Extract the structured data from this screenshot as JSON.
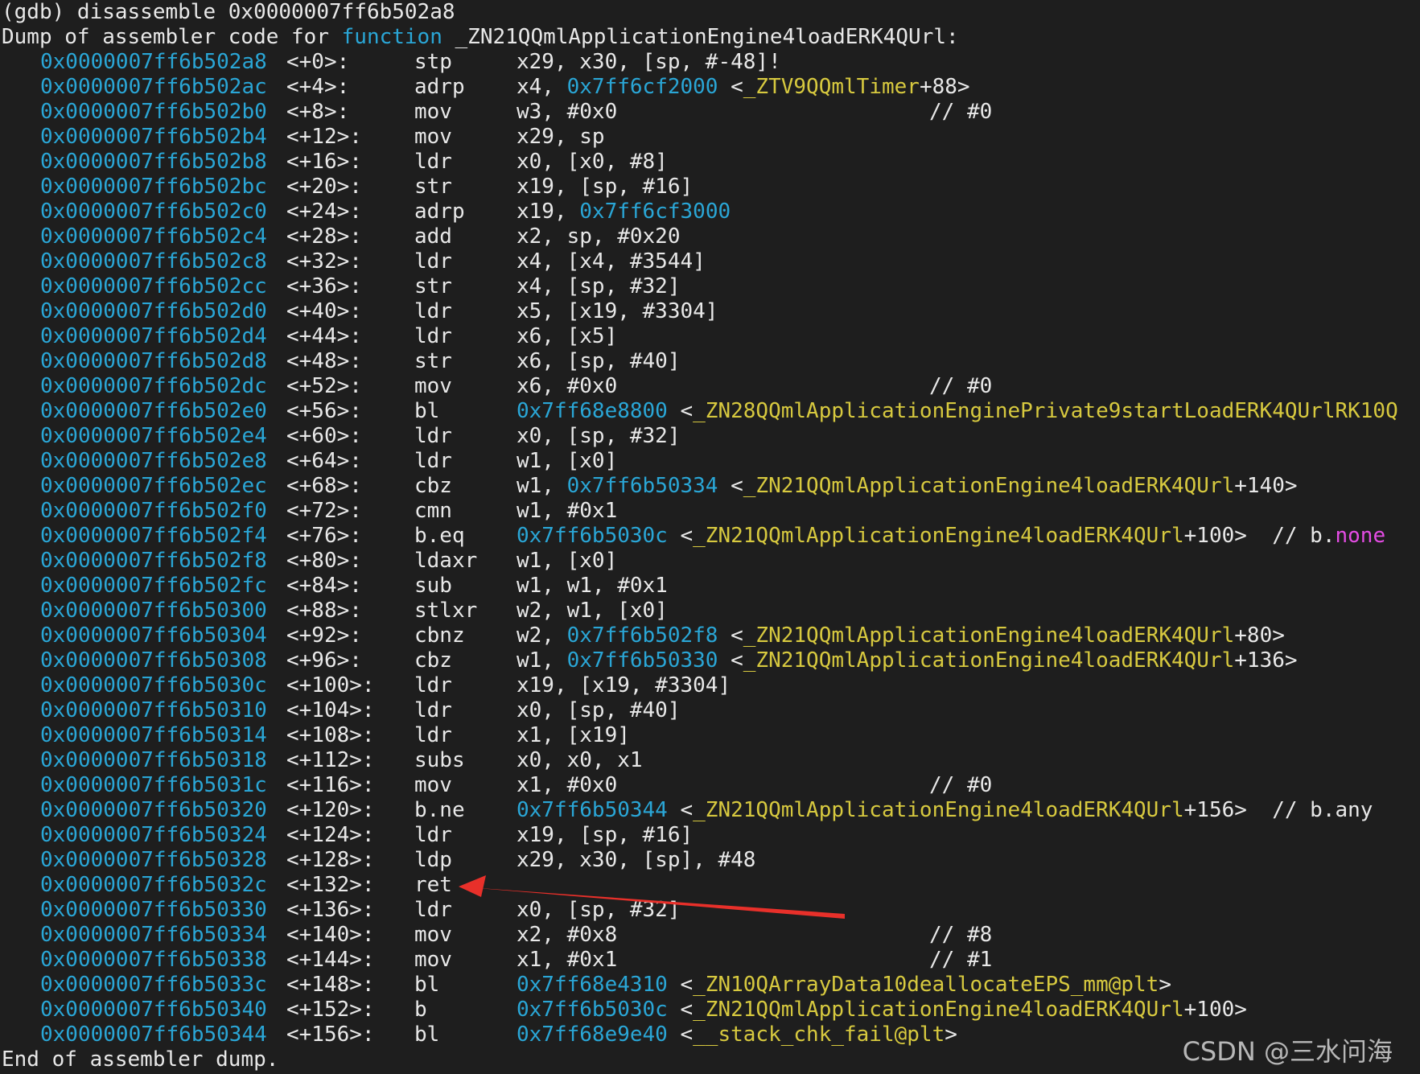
{
  "prompt_line": "(gdb) disassemble 0x0000007ff6b502a8",
  "header": {
    "prefix": "Dump of assembler code for ",
    "keyword": "function",
    "symbol": " _ZN21QQmlApplicationEngine4loadERK4QUrl:"
  },
  "rows": [
    {
      "addr": "0x0000007ff6b502a8",
      "offset": "<+0>:",
      "mnemonic": "stp",
      "operands": [
        {
          "t": "x29, x30, [sp, #-48]!",
          "c": "white"
        }
      ],
      "comment": ""
    },
    {
      "addr": "0x0000007ff6b502ac",
      "offset": "<+4>:",
      "mnemonic": "adrp",
      "operands": [
        {
          "t": "x4, ",
          "c": "white"
        },
        {
          "t": "0x7ff6cf2000",
          "c": "blue"
        },
        {
          "t": " <",
          "c": "white"
        },
        {
          "t": "_ZTV9QQmlTimer",
          "c": "yellow"
        },
        {
          "t": "+88>",
          "c": "white"
        }
      ],
      "comment": ""
    },
    {
      "addr": "0x0000007ff6b502b0",
      "offset": "<+8>:",
      "mnemonic": "mov",
      "operands": [
        {
          "t": "w3, #0x0",
          "c": "white"
        }
      ],
      "comment": "// #0"
    },
    {
      "addr": "0x0000007ff6b502b4",
      "offset": "<+12>:",
      "mnemonic": "mov",
      "operands": [
        {
          "t": "x29, sp",
          "c": "white"
        }
      ],
      "comment": ""
    },
    {
      "addr": "0x0000007ff6b502b8",
      "offset": "<+16>:",
      "mnemonic": "ldr",
      "operands": [
        {
          "t": "x0, [x0, #8]",
          "c": "white"
        }
      ],
      "comment": ""
    },
    {
      "addr": "0x0000007ff6b502bc",
      "offset": "<+20>:",
      "mnemonic": "str",
      "operands": [
        {
          "t": "x19, [sp, #16]",
          "c": "white"
        }
      ],
      "comment": ""
    },
    {
      "addr": "0x0000007ff6b502c0",
      "offset": "<+24>:",
      "mnemonic": "adrp",
      "operands": [
        {
          "t": "x19, ",
          "c": "white"
        },
        {
          "t": "0x7ff6cf3000",
          "c": "blue"
        }
      ],
      "comment": ""
    },
    {
      "addr": "0x0000007ff6b502c4",
      "offset": "<+28>:",
      "mnemonic": "add",
      "operands": [
        {
          "t": "x2, sp, #0x20",
          "c": "white"
        }
      ],
      "comment": ""
    },
    {
      "addr": "0x0000007ff6b502c8",
      "offset": "<+32>:",
      "mnemonic": "ldr",
      "operands": [
        {
          "t": "x4, [x4, #3544]",
          "c": "white"
        }
      ],
      "comment": ""
    },
    {
      "addr": "0x0000007ff6b502cc",
      "offset": "<+36>:",
      "mnemonic": "str",
      "operands": [
        {
          "t": "x4, [sp, #32]",
          "c": "white"
        }
      ],
      "comment": ""
    },
    {
      "addr": "0x0000007ff6b502d0",
      "offset": "<+40>:",
      "mnemonic": "ldr",
      "operands": [
        {
          "t": "x5, [x19, #3304]",
          "c": "white"
        }
      ],
      "comment": ""
    },
    {
      "addr": "0x0000007ff6b502d4",
      "offset": "<+44>:",
      "mnemonic": "ldr",
      "operands": [
        {
          "t": "x6, [x5]",
          "c": "white"
        }
      ],
      "comment": ""
    },
    {
      "addr": "0x0000007ff6b502d8",
      "offset": "<+48>:",
      "mnemonic": "str",
      "operands": [
        {
          "t": "x6, [sp, #40]",
          "c": "white"
        }
      ],
      "comment": ""
    },
    {
      "addr": "0x0000007ff6b502dc",
      "offset": "<+52>:",
      "mnemonic": "mov",
      "operands": [
        {
          "t": "x6, #0x0",
          "c": "white"
        }
      ],
      "comment": "// #0"
    },
    {
      "addr": "0x0000007ff6b502e0",
      "offset": "<+56>:",
      "mnemonic": "bl",
      "operands": [
        {
          "t": "0x7ff68e8800",
          "c": "blue"
        },
        {
          "t": " <",
          "c": "white"
        },
        {
          "t": "_ZN28QQmlApplicationEnginePrivate9startLoadERK4QUrlRK10Q",
          "c": "yellow"
        }
      ],
      "comment": ""
    },
    {
      "addr": "0x0000007ff6b502e4",
      "offset": "<+60>:",
      "mnemonic": "ldr",
      "operands": [
        {
          "t": "x0, [sp, #32]",
          "c": "white"
        }
      ],
      "comment": ""
    },
    {
      "addr": "0x0000007ff6b502e8",
      "offset": "<+64>:",
      "mnemonic": "ldr",
      "operands": [
        {
          "t": "w1, [x0]",
          "c": "white"
        }
      ],
      "comment": ""
    },
    {
      "addr": "0x0000007ff6b502ec",
      "offset": "<+68>:",
      "mnemonic": "cbz",
      "operands": [
        {
          "t": "w1, ",
          "c": "white"
        },
        {
          "t": "0x7ff6b50334",
          "c": "blue"
        },
        {
          "t": " <",
          "c": "white"
        },
        {
          "t": "_ZN21QQmlApplicationEngine4loadERK4QUrl",
          "c": "yellow"
        },
        {
          "t": "+140>",
          "c": "white"
        }
      ],
      "comment": ""
    },
    {
      "addr": "0x0000007ff6b502f0",
      "offset": "<+72>:",
      "mnemonic": "cmn",
      "operands": [
        {
          "t": "w1, #0x1",
          "c": "white"
        }
      ],
      "comment": ""
    },
    {
      "addr": "0x0000007ff6b502f4",
      "offset": "<+76>:",
      "mnemonic": "b.eq",
      "operands": [
        {
          "t": "0x7ff6b5030c",
          "c": "blue"
        },
        {
          "t": " <",
          "c": "white"
        },
        {
          "t": "_ZN21QQmlApplicationEngine4loadERK4QUrl",
          "c": "yellow"
        },
        {
          "t": "+100>  // b.",
          "c": "white"
        },
        {
          "t": "none",
          "c": "magenta"
        }
      ],
      "comment": ""
    },
    {
      "addr": "0x0000007ff6b502f8",
      "offset": "<+80>:",
      "mnemonic": "ldaxr",
      "operands": [
        {
          "t": "w1, [x0]",
          "c": "white"
        }
      ],
      "comment": ""
    },
    {
      "addr": "0x0000007ff6b502fc",
      "offset": "<+84>:",
      "mnemonic": "sub",
      "operands": [
        {
          "t": "w1, w1, #0x1",
          "c": "white"
        }
      ],
      "comment": ""
    },
    {
      "addr": "0x0000007ff6b50300",
      "offset": "<+88>:",
      "mnemonic": "stlxr",
      "operands": [
        {
          "t": "w2, w1, [x0]",
          "c": "white"
        }
      ],
      "comment": ""
    },
    {
      "addr": "0x0000007ff6b50304",
      "offset": "<+92>:",
      "mnemonic": "cbnz",
      "operands": [
        {
          "t": "w2, ",
          "c": "white"
        },
        {
          "t": "0x7ff6b502f8",
          "c": "blue"
        },
        {
          "t": " <",
          "c": "white"
        },
        {
          "t": "_ZN21QQmlApplicationEngine4loadERK4QUrl",
          "c": "yellow"
        },
        {
          "t": "+80>",
          "c": "white"
        }
      ],
      "comment": ""
    },
    {
      "addr": "0x0000007ff6b50308",
      "offset": "<+96>:",
      "mnemonic": "cbz",
      "operands": [
        {
          "t": "w1, ",
          "c": "white"
        },
        {
          "t": "0x7ff6b50330",
          "c": "blue"
        },
        {
          "t": " <",
          "c": "white"
        },
        {
          "t": "_ZN21QQmlApplicationEngine4loadERK4QUrl",
          "c": "yellow"
        },
        {
          "t": "+136>",
          "c": "white"
        }
      ],
      "comment": ""
    },
    {
      "addr": "0x0000007ff6b5030c",
      "offset": "<+100>:",
      "mnemonic": "ldr",
      "operands": [
        {
          "t": "x19, [x19, #3304]",
          "c": "white"
        }
      ],
      "comment": ""
    },
    {
      "addr": "0x0000007ff6b50310",
      "offset": "<+104>:",
      "mnemonic": "ldr",
      "operands": [
        {
          "t": "x0, [sp, #40]",
          "c": "white"
        }
      ],
      "comment": ""
    },
    {
      "addr": "0x0000007ff6b50314",
      "offset": "<+108>:",
      "mnemonic": "ldr",
      "operands": [
        {
          "t": "x1, [x19]",
          "c": "white"
        }
      ],
      "comment": ""
    },
    {
      "addr": "0x0000007ff6b50318",
      "offset": "<+112>:",
      "mnemonic": "subs",
      "operands": [
        {
          "t": "x0, x0, x1",
          "c": "white"
        }
      ],
      "comment": ""
    },
    {
      "addr": "0x0000007ff6b5031c",
      "offset": "<+116>:",
      "mnemonic": "mov",
      "operands": [
        {
          "t": "x1, #0x0",
          "c": "white"
        }
      ],
      "comment": "// #0"
    },
    {
      "addr": "0x0000007ff6b50320",
      "offset": "<+120>:",
      "mnemonic": "b.ne",
      "operands": [
        {
          "t": "0x7ff6b50344",
          "c": "blue"
        },
        {
          "t": " <",
          "c": "white"
        },
        {
          "t": "_ZN21QQmlApplicationEngine4loadERK4QUrl",
          "c": "yellow"
        },
        {
          "t": "+156>  // b.any",
          "c": "white"
        }
      ],
      "comment": ""
    },
    {
      "addr": "0x0000007ff6b50324",
      "offset": "<+124>:",
      "mnemonic": "ldr",
      "operands": [
        {
          "t": "x19, [sp, #16]",
          "c": "white"
        }
      ],
      "comment": ""
    },
    {
      "addr": "0x0000007ff6b50328",
      "offset": "<+128>:",
      "mnemonic": "ldp",
      "operands": [
        {
          "t": "x29, x30, [sp], #48",
          "c": "white"
        }
      ],
      "comment": ""
    },
    {
      "addr": "0x0000007ff6b5032c",
      "offset": "<+132>:",
      "mnemonic": "ret",
      "operands": [],
      "comment": ""
    },
    {
      "addr": "0x0000007ff6b50330",
      "offset": "<+136>:",
      "mnemonic": "ldr",
      "operands": [
        {
          "t": "x0, [sp, #32]",
          "c": "white"
        }
      ],
      "comment": ""
    },
    {
      "addr": "0x0000007ff6b50334",
      "offset": "<+140>:",
      "mnemonic": "mov",
      "operands": [
        {
          "t": "x2, #0x8",
          "c": "white"
        }
      ],
      "comment": "// #8"
    },
    {
      "addr": "0x0000007ff6b50338",
      "offset": "<+144>:",
      "mnemonic": "mov",
      "operands": [
        {
          "t": "x1, #0x1",
          "c": "white"
        }
      ],
      "comment": "// #1"
    },
    {
      "addr": "0x0000007ff6b5033c",
      "offset": "<+148>:",
      "mnemonic": "bl",
      "operands": [
        {
          "t": "0x7ff68e4310",
          "c": "blue"
        },
        {
          "t": " <",
          "c": "white"
        },
        {
          "t": "_ZN10QArrayData10deallocateEPS_mm@plt",
          "c": "yellow"
        },
        {
          "t": ">",
          "c": "white"
        }
      ],
      "comment": ""
    },
    {
      "addr": "0x0000007ff6b50340",
      "offset": "<+152>:",
      "mnemonic": "b",
      "operands": [
        {
          "t": "0x7ff6b5030c",
          "c": "blue"
        },
        {
          "t": " <",
          "c": "white"
        },
        {
          "t": "_ZN21QQmlApplicationEngine4loadERK4QUrl",
          "c": "yellow"
        },
        {
          "t": "+100>",
          "c": "white"
        }
      ],
      "comment": ""
    },
    {
      "addr": "0x0000007ff6b50344",
      "offset": "<+156>:",
      "mnemonic": "bl",
      "operands": [
        {
          "t": "0x7ff68e9e40",
          "c": "blue"
        },
        {
          "t": " <",
          "c": "white"
        },
        {
          "t": "__stack_chk_fail@plt",
          "c": "yellow"
        },
        {
          "t": ">",
          "c": "white"
        }
      ],
      "comment": ""
    }
  ],
  "footer": "End of assembler dump.",
  "watermark": "CSDN @三水问海",
  "annotation": {
    "type": "arrow",
    "target_row_index": 33,
    "color": "#e8302a"
  },
  "colors": {
    "background": "#1e1e1e",
    "text": "#e8e8e8",
    "address": "#2aa6d6",
    "symbol": "#d7c93f",
    "keyword_none": "#e44ce4",
    "arrow": "#e8302a"
  }
}
